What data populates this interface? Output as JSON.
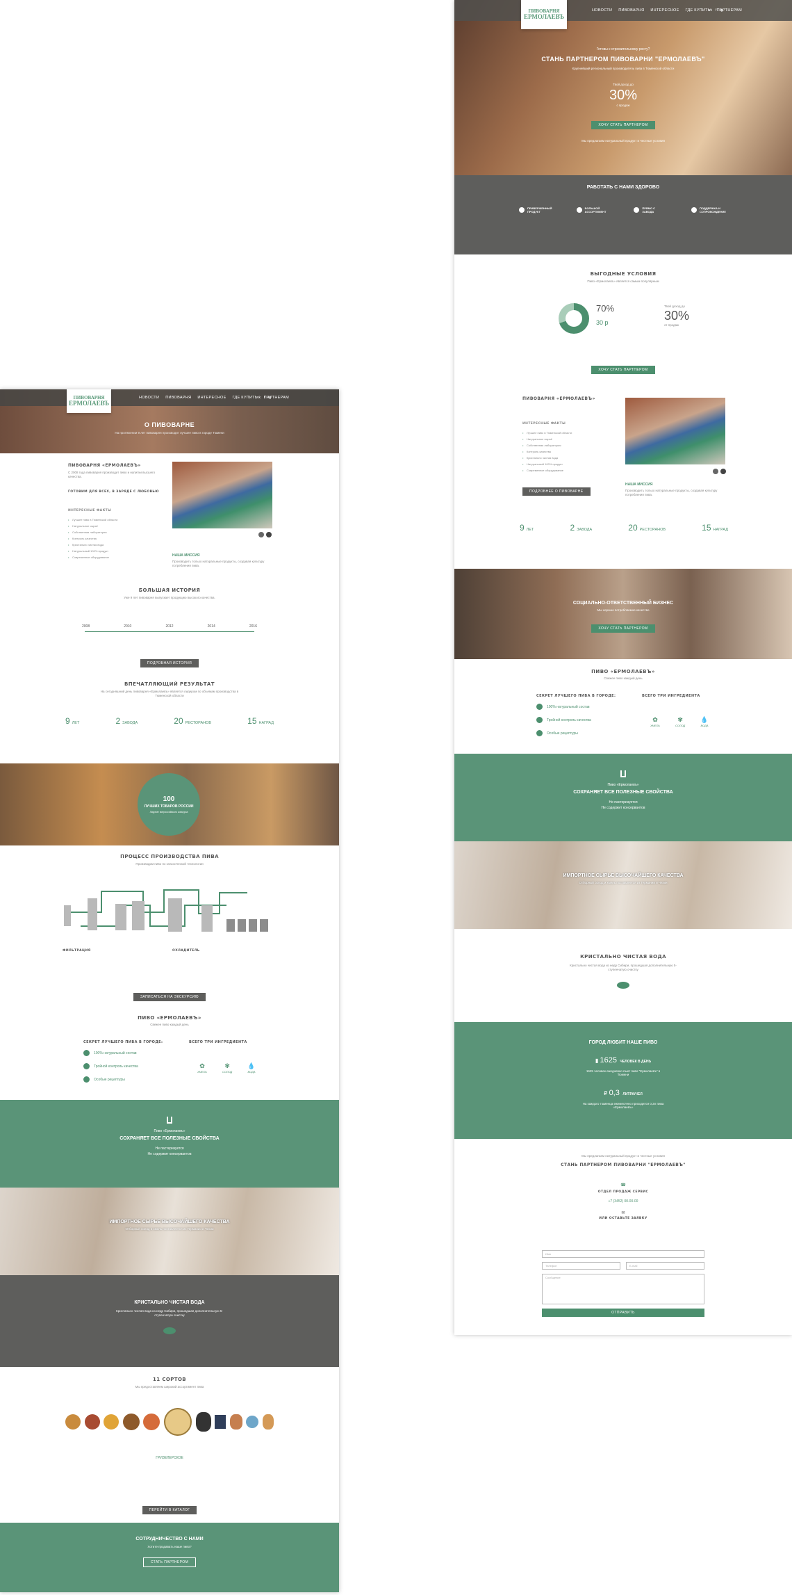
{
  "nav": {
    "logo_top": "ПИВОВАРНЯ",
    "logo_bottom": "ЕРМОЛАЕВЪ",
    "menu_left": [
      "НОВОСТИ",
      "ПИВОВАРНЯ",
      "ИНТЕРЕСНОЕ",
      "ГДЕ КУПИТЬ",
      "ПАРТНЕРАМ"
    ],
    "menu_right": [
      "НОВОСТИ",
      "ПИВОВАРНЯ",
      "ИНТЕРЕСНОЕ",
      "ГДЕ КУПИТЬ",
      "ПАРТНЕРАМ"
    ],
    "social": [
      "vk",
      "f",
      "ig"
    ]
  },
  "left": {
    "hero_title": "О ПИВОВАРНЕ",
    "hero_text": "На протяжении 9 лет пивоварня производит лучшее пиво в городе Тюмени",
    "about_title": "ПИВОВАРНЯ «ЕРМОЛАЕВЪ»",
    "about_text": "С 2008 года пивоварня производит пиво и напитки высшего качества.",
    "lead_title": "ГОТОВИМ ДЛЯ ВСЕХ, В ЗАРЯДЕ С ЛЮБОВЬЮ",
    "facts_title": "ИНТЕРЕСНЫЕ ФАКТЫ",
    "facts": [
      "Лучшее пиво в Тюменской области",
      "Натуральное сырьё",
      "Собственная лаборатория",
      "Контроль качества",
      "Кристально чистая вода",
      "Натуральный 100% продукт",
      "Современное оборудование"
    ],
    "mission_title": "НАША МИССИЯ",
    "mission_text": "Производить только натуральные продукты, создавая культуру потребления пива.",
    "history_title": "БОЛЬШАЯ ИСТОРИЯ",
    "history_text": "Уже 9 лет пивоварня выпускает продукцию высокого качества.",
    "years": [
      "2008",
      "2010",
      "2012",
      "2014",
      "2016"
    ],
    "history_btn": "ПОДРОБНАЯ ИСТОРИЯ",
    "result_title": "ВПЕЧАТЛЯЮЩИЙ РЕЗУЛЬТАТ",
    "result_text": "На сегодняшний день пивоварня «Ермолаевъ» является лидером по объемам производства в Тюменской области",
    "stats": [
      {
        "n": "9",
        "l": "ЛЕТ"
      },
      {
        "n": "2",
        "l": "ЗАВОДА"
      },
      {
        "n": "20",
        "l": "РЕСТОРАНОВ"
      },
      {
        "n": "15",
        "l": "НАГРАД"
      }
    ],
    "award_number": "100",
    "award_title": "ЛУЧШИХ ТОВАРОВ РОССИИ",
    "award_sub": "Лауреат всероссийского конкурса",
    "process_title": "ПРОЦЕСС ПРОИЗВОДСТВА ПИВА",
    "process_text": "Производим пиво по классической технологии",
    "process_col1": "ФИЛЬТРАЦИЯ",
    "process_col2": "ОХЛАДИТЕЛЬ",
    "excursion_btn": "ЗАПИСАТЬСЯ НА ЭКСКУРСИЮ",
    "beer_title": "ПИВО «ЕРМОЛАЕВЪ»",
    "beer_sub": "Свежее пиво каждый день",
    "secret_title": "СЕКРЕТ ЛУЧШЕГО ПИВА В ГОРОДЕ:",
    "secret_items": [
      "100% натуральный состав",
      "Тройной контроль качества",
      "Особые рецептуры"
    ],
    "ingr_title": "ВСЕГО ТРИ ИНГРЕДИЕНТА",
    "ingr": [
      {
        "icon": "✿",
        "l": "ХМЕЛЬ"
      },
      {
        "icon": "✾",
        "l": "СОЛОД"
      },
      {
        "icon": "💧",
        "l": "ВОДА"
      }
    ],
    "keeps_small": "Пиво «Ермолаевъ»",
    "keeps_title": "СОХРАНЯЕТ ВСЕ ПОЛЕЗНЫЕ СВОЙСТВА",
    "keeps_line1": "Не пастеризуется",
    "keeps_line2": "Не содержит консервантов",
    "import_title": "ИМПОРТНОЕ СЫРЬЕ ВЫСОЧАЙШЕГО КАЧЕСТВА",
    "import_text": "Отборный солод и хмель поставляется из Германии и Чехии",
    "water_title": "КРИСТАЛЬНО ЧИСТАЯ ВОДА",
    "water_text": "Кристально чистая вода из недр Сибири, прошедшая дополнительную 5-ступенчатую очистку",
    "sorts_title": "11 СОРТОВ",
    "sorts_text": "Мы предоставляем широкий ассортимент пива",
    "sort_name": "ГРИЗЕЛЕРСКОЕ",
    "catalog_btn": "ПЕРЕЙТИ В КАТАЛОГ",
    "coop_title": "СОТРУДНИЧЕСТВО С НАМИ",
    "coop_text": "Хотите продавать наше пиво?",
    "coop_btn": "СТАТЬ ПАРТНЕРОМ"
  },
  "right": {
    "hero_kicker": "Готовы к стремительному росту?",
    "hero_title": "СТАНЬ ПАРТНЕРОМ ПИВОВАРНИ \"ЕРМОЛАЕВЪ\"",
    "hero_sub": "Крупнейший региональный производитель пива в Тюменской области",
    "income_label": "Твой доход до",
    "income_value": "30%",
    "income_sub": "с продаж",
    "hero_btn": "ХОЧУ СТАТЬ ПАРТНЕРОМ",
    "hero_note": "Мы предлагаем натуральный продукт и честные условия",
    "work_title": "РАБОТАТЬ С НАМИ ЗДОРОВО",
    "work_items": [
      "ПРИВЕРЖЕННЫЙ ПРОДУКТ",
      "БОЛЬШОЙ АССОРТИМЕНТ",
      "ПРЯМО С ЗАВОДА",
      "ПОДДЕРЖКА И СОПРОВОЖДЕНИЕ"
    ],
    "terms_title": "ВЫГОДНЫЕ УСЛОВИЯ",
    "terms_text": "Пиво «Ермолаевъ» является самым популярным",
    "pct70": "70%",
    "rub30": "30 р",
    "terms_income_label": "Твой доход до",
    "terms_income": "30%",
    "terms_income_sub": "от продаж",
    "terms_btn": "ХОЧУ СТАТЬ ПАРТНЕРОМ",
    "about_title": "ПИВОВАРНЯ «ЕРМОЛАЕВЪ»",
    "facts_title": "ИНТЕРЕСНЫЕ ФАКТЫ",
    "facts": [
      "Лучшее пиво в Тюменской области",
      "Натуральное сырьё",
      "Собственная лаборатория",
      "Контроль качества",
      "Кристально чистая вода",
      "Натуральный 100% продукт",
      "Современное оборудование"
    ],
    "about_btn": "ПОДРОБНЕЕ О ПИВОВАРНЕ",
    "mission_title": "НАША МИССИЯ",
    "mission_text": "Производить только натуральные продукты, создавая культуру потребления пива.",
    "stats": [
      {
        "n": "9",
        "l": "ЛЕТ"
      },
      {
        "n": "2",
        "l": "ЗАВОДА"
      },
      {
        "n": "20",
        "l": "РЕСТОРАНОВ"
      },
      {
        "n": "15",
        "l": "НАГРАД"
      }
    ],
    "social_title": "СОЦИАЛЬНО-ОТВЕТСТВЕННЫЙ БИЗНЕС",
    "social_text": "Мы хорошо потребляемое качество",
    "social_btn": "ХОЧУ СТАТЬ ПАРТНЕРОМ",
    "beer_title": "ПИВО «ЕРМОЛАЕВЪ»",
    "beer_sub": "Свежее пиво каждый день",
    "secret_title": "СЕКРЕТ ЛУЧШЕГО ПИВА В ГОРОДЕ:",
    "secret_items": [
      "100% натуральный состав",
      "Тройной контроль качества",
      "Особые рецептуры"
    ],
    "ingr_title": "ВСЕГО ТРИ ИНГРЕДИЕНТА",
    "ingr": [
      {
        "icon": "✿",
        "l": "ХМЕЛЬ"
      },
      {
        "icon": "✾",
        "l": "СОЛОД"
      },
      {
        "icon": "💧",
        "l": "ВОДА"
      }
    ],
    "keeps_small": "Пиво «Ермолаевъ»",
    "keeps_title": "СОХРАНЯЕТ ВСЕ ПОЛЕЗНЫЕ СВОЙСТВА",
    "keeps_line1": "Не пастеризуется",
    "keeps_line2": "Не содержит консервантов",
    "import_title": "ИМПОРТНОЕ СЫРЬЕ ВЫСОЧАЙШЕГО КАЧЕСТВА",
    "import_text": "Отборный солод и хмель поставляется из Германии и Чехии",
    "water_title": "КРИСТАЛЬНО ЧИСТАЯ ВОДА",
    "water_text": "Кристально чистая вода из недр Сибири, прошедшая дополнительную 5-ступенчатую очистку",
    "city_title": "ГОРОД ЛЮБИТ НАШЕ ПИВО",
    "city_n1": "1625",
    "city_l1": "ЧЕЛОВЕК В ДЕНЬ",
    "city_t1": "1625 человек ежедневно пьют пиво \"Ермолаевъ\" в Тюмени",
    "city_n2": "0,3",
    "city_l2": "ЛИТРА/ЧЕЛ",
    "city_t2": "На каждого тюменца ежемесячно приходится 0,3л пива «Ермолаевъ»",
    "final_note": "Мы предлагаем натуральный продукт и честные условия",
    "final_title": "СТАНЬ ПАРТНЕРОМ ПИВОВАРНИ \"ЕРМОЛАЕВЪ\"",
    "contact_title": "ОТДЕЛ ПРОДАЖ СЕРВИС",
    "phone": "+7 (3452) 00-00-00",
    "form_title": "ИЛИ ОСТАВЬТЕ ЗАЯВКУ",
    "f_name": "Имя",
    "f_phone": "Телефон",
    "f_email": "E-mail",
    "f_msg": "Сообщение",
    "send_btn": "ОТПРАВИТЬ"
  }
}
